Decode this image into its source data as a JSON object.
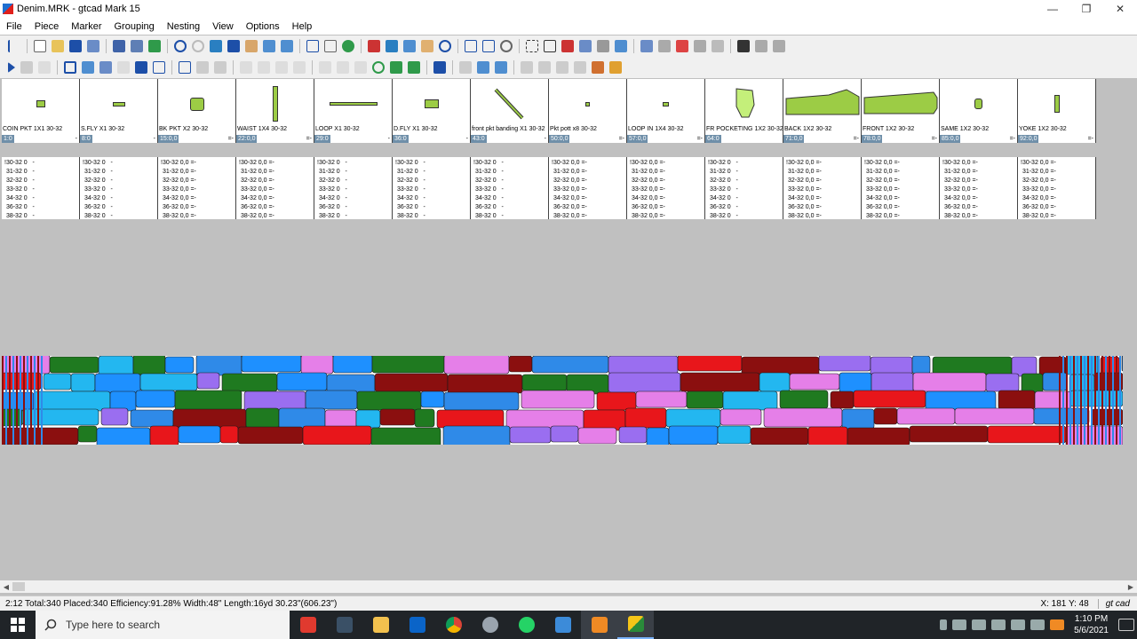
{
  "window": {
    "title": "Denim.MRK - gtcad Mark 15",
    "minimize": "—",
    "restore": "❐",
    "close": "✕"
  },
  "menu": [
    "File",
    "Piece",
    "Marker",
    "Grouping",
    "Nesting",
    "View",
    "Options",
    "Help"
  ],
  "pieces": [
    {
      "name": "COIN PKT 1X1 30-32",
      "num": "1:0",
      "tag": "-"
    },
    {
      "name": "S.FLY X1 30-32",
      "num": "8:0",
      "tag": "-"
    },
    {
      "name": "BK PKT X2 30-32",
      "num": "15:0,0",
      "tag": "=-"
    },
    {
      "name": "WAIST 1X4 30-32",
      "num": "22:0,0",
      "tag": "=-"
    },
    {
      "name": "LOOP X1 30-32",
      "num": "29:0",
      "tag": "-"
    },
    {
      "name": "D.FLY X1 30-32",
      "num": "36:0",
      "tag": "-"
    },
    {
      "name": "front pkt banding X1 30-32",
      "num": "43:0",
      "tag": "-"
    },
    {
      "name": "Pkt pott x8 30-32",
      "num": "50:0,0",
      "tag": "=-"
    },
    {
      "name": "LOOP IN 1X4 30-32",
      "num": "57:0,0",
      "tag": "=-"
    },
    {
      "name": "FR POCKETING 1X2 30-32",
      "num": "64:0",
      "tag": ""
    },
    {
      "name": "BACK 1X2 30-32",
      "num": "71:0,0",
      "tag": "=-"
    },
    {
      "name": "FRONT 1X2 30-32",
      "num": "78:0,0",
      "tag": "=-"
    },
    {
      "name": "SAME 1X2 30-32",
      "num": "85:0,0",
      "tag": "=-"
    },
    {
      "name": "YOKE 1X2 30-32",
      "num": "92:0,0",
      "tag": "=-"
    }
  ],
  "size_columns": [
    [
      "!30-32 0   -",
      " 31-32 0   -",
      " 32-32 0   -",
      " 33-32 0   -",
      " 34-32 0   -",
      " 36-32 0   -",
      " 38-32 0   -"
    ],
    [
      "!30-32 0   -",
      " 31-32 0   -",
      " 32-32 0   -",
      " 33-32 0   -",
      " 34-32 0   -",
      " 36-32 0   -",
      " 38-32 0   -"
    ],
    [
      "!30-32 0,0 =-",
      " 31-32 0,0 =-",
      " 32-32 0,0 =-",
      " 33-32 0,0 =-",
      " 34-32 0,0 =-",
      " 36-32 0,0 =-",
      " 38-32 0,0 =-"
    ],
    [
      "!30-32 0,0 =-",
      " 31-32 0,0 =-",
      " 32-32 0,0 =-",
      " 33-32 0,0 =-",
      " 34-32 0,0 =-",
      " 36-32 0,0 =-",
      " 38-32 0,0 =-"
    ],
    [
      "!30-32 0   -",
      " 31-32 0   -",
      " 32-32 0   -",
      " 33-32 0   -",
      " 34-32 0   -",
      " 36-32 0   -",
      " 38-32 0   -"
    ],
    [
      "!30-32 0   -",
      " 31-32 0   -",
      " 32-32 0   -",
      " 33-32 0   -",
      " 34-32 0   -",
      " 36-32 0   -",
      " 38-32 0   -"
    ],
    [
      "!30-32 0   -",
      " 31-32 0   -",
      " 32-32 0   -",
      " 33-32 0   -",
      " 34-32 0   -",
      " 36-32 0   -",
      " 38-32 0   -"
    ],
    [
      "!30-32 0,0 =-",
      " 31-32 0,0 =-",
      " 32-32 0,0 =-",
      " 33-32 0,0 =-",
      " 34-32 0,0 =-",
      " 36-32 0,0 =-",
      " 38-32 0,0 =-"
    ],
    [
      "!30-32 0,0 =-",
      " 31-32 0,0 =-",
      " 32-32 0,0 =-",
      " 33-32 0,0 =-",
      " 34-32 0,0 =-",
      " 36-32 0,0 =-",
      " 38-32 0,0 =-"
    ],
    [
      "!30-32 0   -",
      " 31-32 0   -",
      " 32-32 0   -",
      " 33-32 0   -",
      " 34-32 0   -",
      " 36-32 0   -",
      " 38-32 0   -"
    ],
    [
      "!30-32 0,0 =-",
      " 31-32 0,0 =-",
      " 32-32 0,0 =-",
      " 33-32 0,0 =-",
      " 34-32 0,0 =-",
      " 36-32 0,0 =-",
      " 38-32 0,0 =-"
    ],
    [
      "!30-32 0,0 =-",
      " 31-32 0,0 =-",
      " 32-32 0,0 =-",
      " 33-32 0,0 =-",
      " 34-32 0,0 =-",
      " 36-32 0,0 =-",
      " 38-32 0,0 =-"
    ],
    [
      "!30-32 0,0 =-",
      " 31-32 0,0 =-",
      " 32-32 0,0 =-",
      " 33-32 0,0 =-",
      " 34-32 0,0 =-",
      " 36-32 0,0 =-",
      " 38-32 0,0 =-"
    ],
    [
      "!30-32 0,0 =-",
      " 31-32 0,0 =-",
      " 32-32 0,0 =-",
      " 33-32 0,0 =-",
      " 34-32 0,0 =-",
      " 36-32 0,0 =-",
      " 38-32 0,0 =-"
    ]
  ],
  "marker_colors": [
    "#23b7f0",
    "#e57fe8",
    "#9a6ef0",
    "#2f8ae8",
    "#1f7a20",
    "#8b0f0f",
    "#e8161b",
    "#1e90ff"
  ],
  "status": {
    "main": "2:12  Total:340  Placed:340  Efficiency:91.28%  Width:48\"  Length:16yd 30.23\"(606.23\")",
    "coords": "X: 181  Y: 48",
    "brand": "gt cad"
  },
  "taskbar": {
    "search_placeholder": "Type here to search",
    "time": "1:10 PM",
    "date": "5/6/2021"
  }
}
